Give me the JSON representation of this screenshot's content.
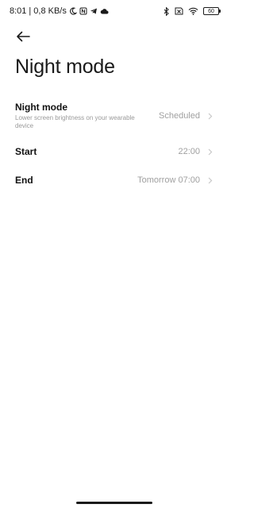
{
  "status_bar": {
    "time": "8:01",
    "separator": "|",
    "net_speed": "0,8 KB/s",
    "battery": "60",
    "icons_left": [
      "moon-icon",
      "nfc-icon",
      "telegram-icon",
      "cloud-icon"
    ],
    "icons_right": [
      "bluetooth-icon",
      "sim-x-icon",
      "wifi-icon",
      "battery-icon"
    ]
  },
  "header": {
    "back_icon": "back-arrow-icon",
    "title": "Night mode"
  },
  "settings": {
    "night_mode": {
      "title": "Night mode",
      "subtitle": "Lower screen brightness on your wearable device",
      "value": "Scheduled"
    },
    "start": {
      "title": "Start",
      "value": "22:00"
    },
    "end": {
      "title": "End",
      "value": "Tomorrow 07:00"
    }
  },
  "colors": {
    "text_primary": "#111111",
    "text_secondary": "#a0a0a0",
    "background": "#ffffff"
  }
}
